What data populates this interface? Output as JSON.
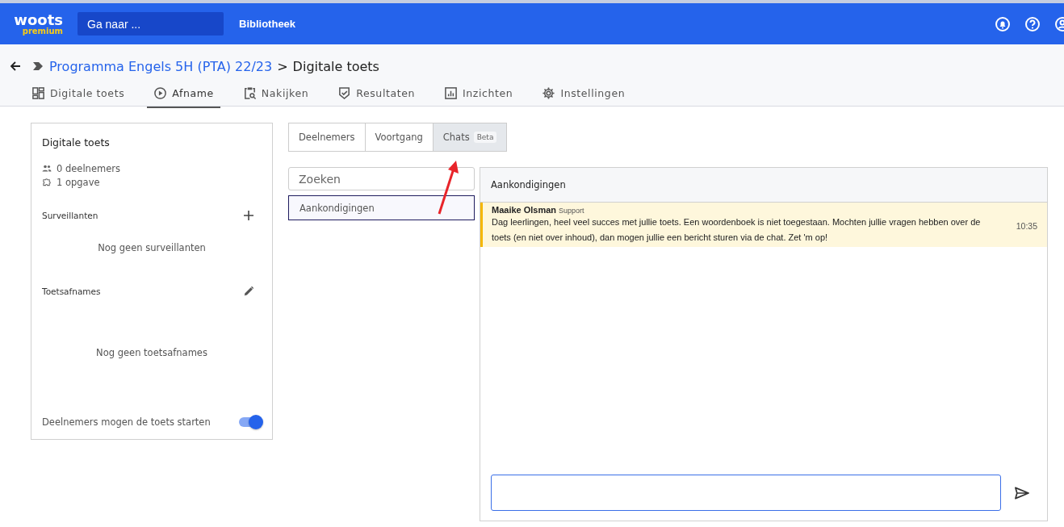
{
  "header": {
    "logo": "woots",
    "logo_sub": "premium",
    "search": {
      "placeholder": "Ga naar ..."
    },
    "nav_link": "Bibliotheek"
  },
  "breadcrumb": {
    "parent": "Programma Engels 5H (PTA) 22/23",
    "separator": ">",
    "current": "Digitale toets"
  },
  "main_tabs": [
    {
      "label": "Digitale toets",
      "kind": "grid",
      "selected": false
    },
    {
      "label": "Afname",
      "kind": "play",
      "selected": true
    },
    {
      "label": "Nakijken",
      "kind": "clipboard",
      "selected": false
    },
    {
      "label": "Resultaten",
      "kind": "shield",
      "selected": false
    },
    {
      "label": "Inzichten",
      "kind": "chart",
      "selected": false
    },
    {
      "label": "Instellingen",
      "kind": "gear",
      "selected": false
    }
  ],
  "sidebar": {
    "title": "Digitale toets",
    "participants": "0 deelnemers",
    "tasks": "1 opgave",
    "supervisors": {
      "title": "Surveillanten",
      "empty": "Nog geen surveillanten"
    },
    "sessions": {
      "title": "Toetsafnames",
      "empty": "Nog geen toetsafnames"
    },
    "toggle": {
      "label": "Deelnemers mogen de toets starten",
      "on": true
    }
  },
  "sub_tabs": [
    {
      "label": "Deelnemers",
      "selected": false
    },
    {
      "label": "Voortgang",
      "selected": false
    },
    {
      "label": "Chats",
      "badge": "Beta",
      "selected": true
    }
  ],
  "chat_search": {
    "placeholder": "Zoeken"
  },
  "channels": [
    {
      "label": "Aankondigingen",
      "selected": true
    }
  ],
  "chat": {
    "title": "Aankondigingen",
    "messages": [
      {
        "author": "Maaike Olsman",
        "role": "Support",
        "text": "Dag leerlingen, heel veel succes met jullie toets. Een woordenboek is niet toegestaan. Mochten jullie vragen hebben over de toets (en niet over inhoud), dan mogen jullie een bericht sturen via de chat. Zet 'm op!",
        "time": "10:35"
      }
    ]
  }
}
